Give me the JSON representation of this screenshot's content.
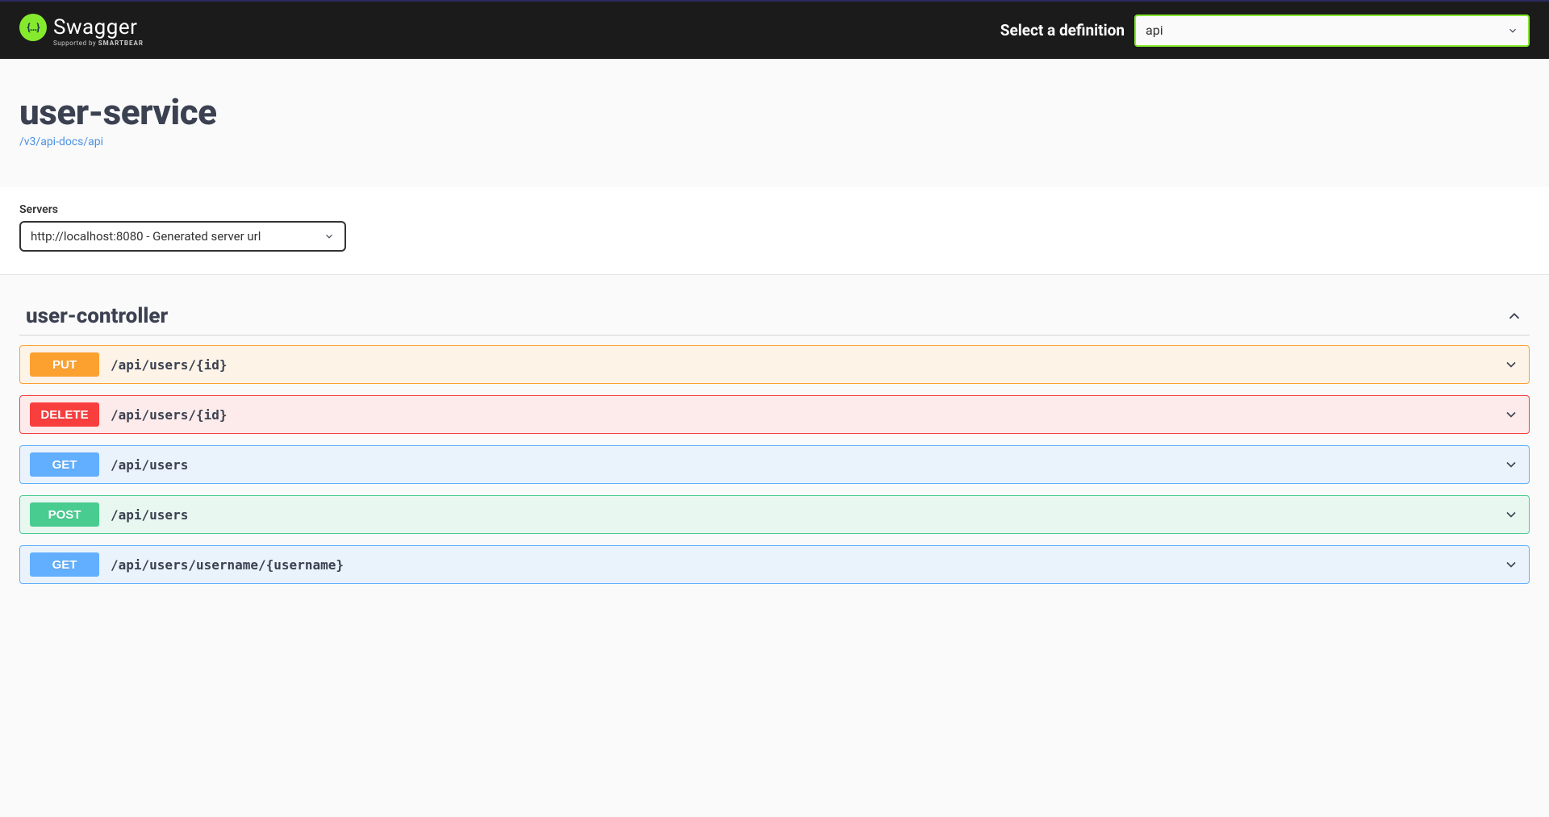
{
  "topbar": {
    "logo_text": "Swagger",
    "logo_sub_prefix": "Supported by ",
    "logo_sub_strong": "SMARTBEAR",
    "def_label": "Select a definition",
    "def_value": "api"
  },
  "info": {
    "title": "user-service",
    "docs_link": "/v3/api-docs/api"
  },
  "servers": {
    "label": "Servers",
    "selected": "http://localhost:8080 - Generated server url"
  },
  "tag": {
    "name": "user-controller"
  },
  "operations": [
    {
      "method": "PUT",
      "path": "/api/users/{id}",
      "cls": "op-put"
    },
    {
      "method": "DELETE",
      "path": "/api/users/{id}",
      "cls": "op-delete"
    },
    {
      "method": "GET",
      "path": "/api/users",
      "cls": "op-get"
    },
    {
      "method": "POST",
      "path": "/api/users",
      "cls": "op-post"
    },
    {
      "method": "GET",
      "path": "/api/users/username/{username}",
      "cls": "op-get"
    }
  ]
}
